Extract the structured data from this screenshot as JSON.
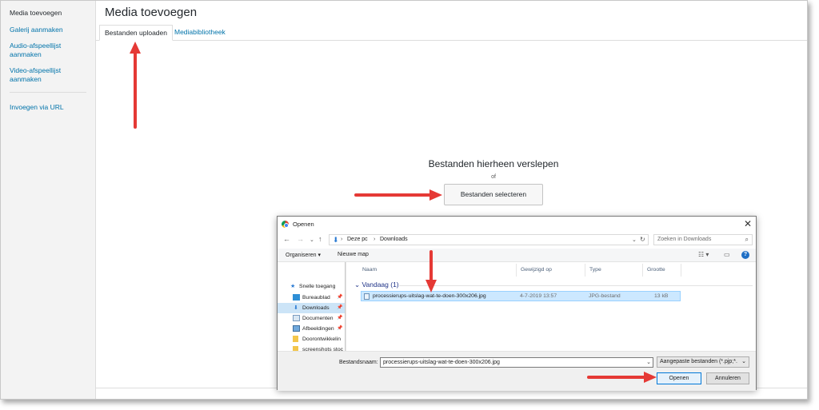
{
  "sidebar": {
    "items": [
      {
        "label": "Media toevoegen"
      },
      {
        "label": "Galerij aanmaken"
      },
      {
        "label": "Audio-afspeellijst aanmaken"
      },
      {
        "label": "Video-afspeellijst aanmaken"
      },
      {
        "label": "Invoegen via URL"
      }
    ]
  },
  "header": {
    "title": "Media toevoegen"
  },
  "tabs": [
    {
      "label": "Bestanden uploaden",
      "active": true
    },
    {
      "label": "Mediabibliotheek",
      "active": false
    }
  ],
  "uploader": {
    "drop_title": "Bestanden hierheen verslepen",
    "or_text": "of",
    "select_button": "Bestanden selecteren"
  },
  "dialog": {
    "title": "Openen",
    "breadcrumb": [
      "Deze pc",
      "Downloads"
    ],
    "search_placeholder": "Zoeken in Downloads",
    "toolbar": {
      "organize": "Organiseren",
      "new_folder": "Nieuwe map"
    },
    "nav_items": [
      {
        "label": "Snelle toegang",
        "icon": "star-icon",
        "selected": false,
        "pinned": false
      },
      {
        "label": "Bureaublad",
        "icon": "desktop-icon",
        "selected": false,
        "pinned": true
      },
      {
        "label": "Downloads",
        "icon": "download-icon",
        "selected": true,
        "pinned": true
      },
      {
        "label": "Documenten",
        "icon": "documents-icon",
        "selected": false,
        "pinned": true
      },
      {
        "label": "Afbeeldingen",
        "icon": "pictures-icon",
        "selected": false,
        "pinned": true
      },
      {
        "label": "Doorontwikkelin",
        "icon": "folder-icon",
        "selected": false,
        "pinned": false
      },
      {
        "label": "screenshots stoc",
        "icon": "folder-icon",
        "selected": false,
        "pinned": false
      }
    ],
    "columns": {
      "name": "Naam",
      "modified": "Gewijzigd op",
      "type": "Type",
      "size": "Grootte"
    },
    "group_label": "Vandaag (1)",
    "file": {
      "name": "processierups-uitslag-wat-te-doen-300x206.jpg",
      "modified": "4-7-2019 13:57",
      "type": "JPG-bestand",
      "size": "13 kB"
    },
    "filename_label": "Bestandsnaam:",
    "filename_value": "processierups-uitslag-wat-te-doen-300x206.jpg",
    "filetype_value": "Aangepaste bestanden (*.pjp;*.",
    "open_button": "Openen",
    "cancel_button": "Annuleren"
  },
  "colors": {
    "accent": "#0073aa",
    "arrow": "#e53935",
    "selection": "#cce8ff"
  }
}
